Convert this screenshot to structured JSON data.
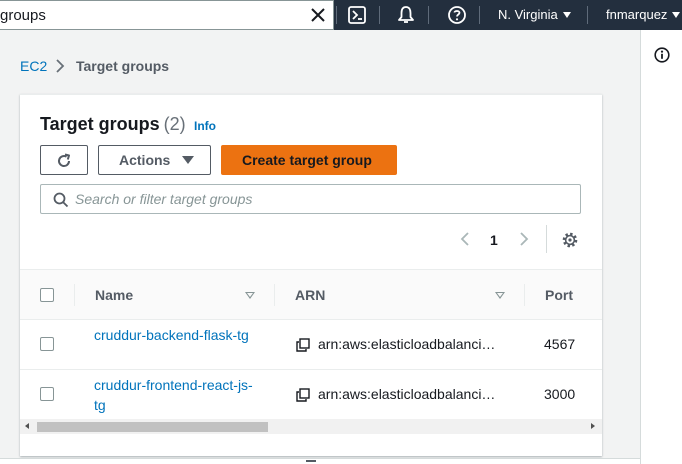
{
  "topbar": {
    "search_value": "groups",
    "region": "N. Virginia",
    "user": "fnmarquez",
    "icons": [
      "close-icon",
      "cloudshell-icon",
      "bell-icon",
      "help-icon"
    ]
  },
  "breadcrumb": {
    "root": "EC2",
    "current": "Target groups"
  },
  "panel": {
    "title": "Target groups",
    "count": "(2)",
    "info": "Info",
    "actions_label": "Actions",
    "create_label": "Create target group",
    "filter_placeholder": "Search or filter target groups",
    "page": "1"
  },
  "table": {
    "columns": [
      "Name",
      "ARN",
      "Port"
    ],
    "rows": [
      {
        "name": "cruddur-backend-flask-tg",
        "arn": "arn:aws:elasticloadbalanci…",
        "port": "4567"
      },
      {
        "name": "cruddur-frontend-react-js-tg",
        "arn": "arn:aws:elasticloadbalanci…",
        "port": "3000"
      }
    ]
  },
  "colors": {
    "nav_bg": "#232f3e",
    "link": "#0073bb",
    "primary_button": "#ec7211"
  }
}
